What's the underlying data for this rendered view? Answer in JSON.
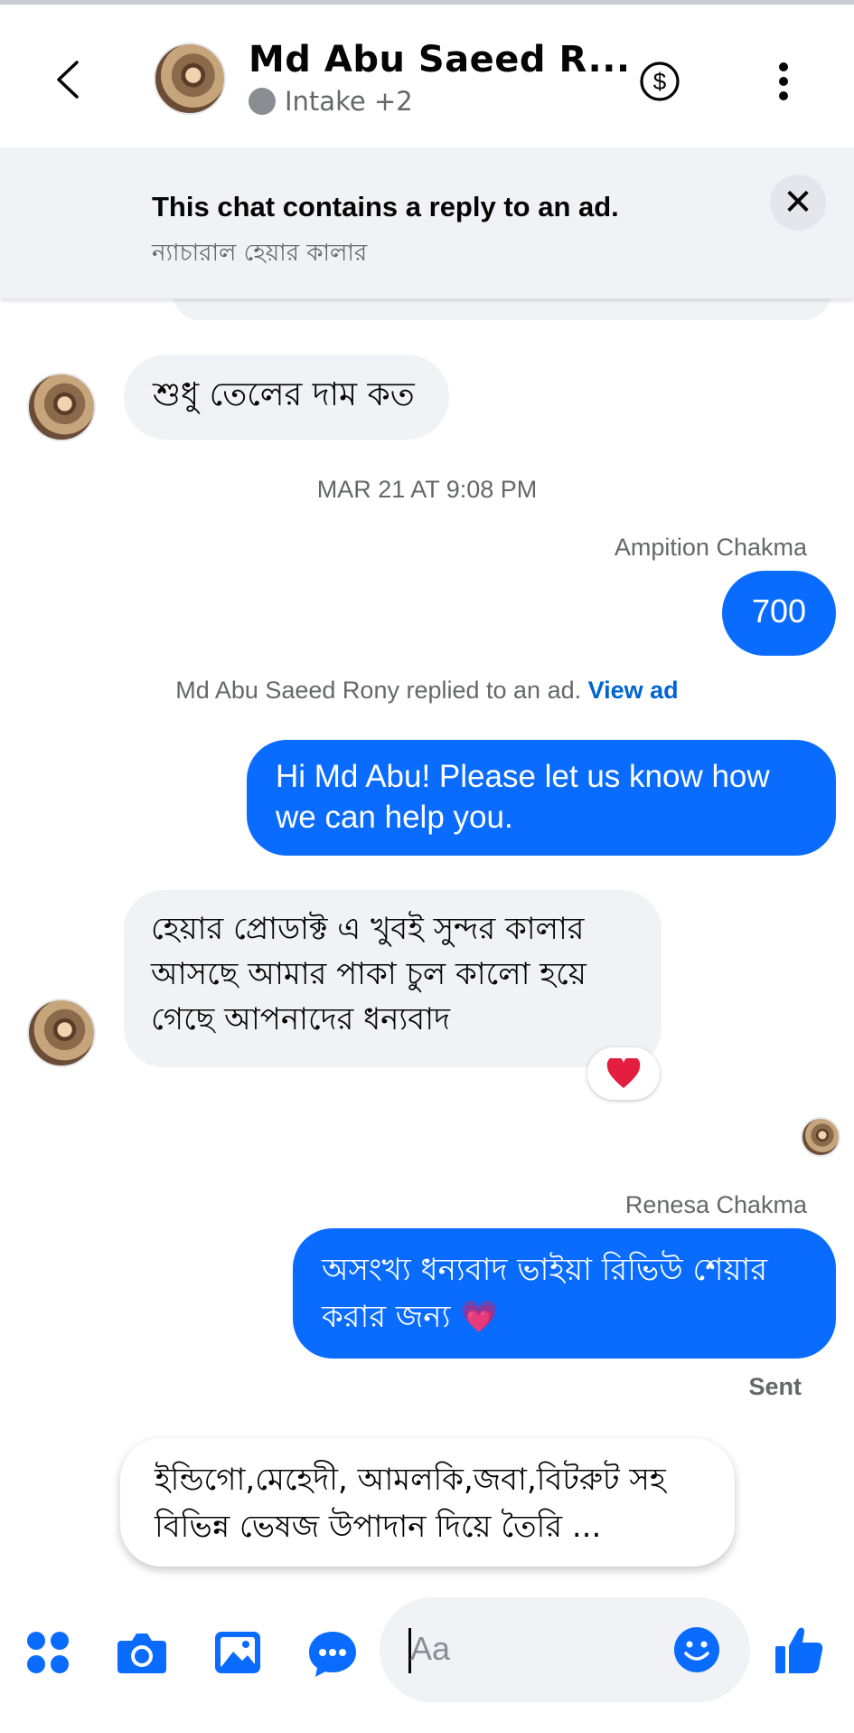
{
  "header": {
    "contact_name": "Md Abu Saeed R...",
    "status_label": "Intake +2",
    "icons": [
      "back-icon",
      "dollar-icon",
      "more-vertical-icon"
    ]
  },
  "ad_banner": {
    "title": "This chat contains a reply to an ad.",
    "subtitle": "ন্যাচারাল হেয়ার কালার",
    "close": "✕"
  },
  "messages": {
    "m1": "শুধু তেলের দাম কত",
    "timestamp": "MAR 21 AT 9:08 PM",
    "sender1": "Ampition Chakma",
    "m2": "700",
    "notice_text": "Md Abu Saeed Rony replied to an ad.",
    "notice_link": "View ad",
    "m3": "Hi Md Abu! Please let us know how we can help you.",
    "m4": "হেয়ার প্রোডাক্ট এ খুবই সুন্দর কালার আসছে আমার পাকা চুল কালো হয়ে গেছে আপনাদের  ধন্যবাদ",
    "reaction": "❤️",
    "sender2": "Renesa Chakma",
    "m5": "অসংখ্য ধন্যবাদ ভাইয়া রিভিউ শেয়ার করার জন্য",
    "m5_emoji": "💗",
    "status": "Sent"
  },
  "suggestion": "ইন্ডিগো,মেহেদী, আমলকি,জবা,বিটরুট সহ বিভিন্ন ভেষজ উপাদান দিয়ে তৈরি ...",
  "composer": {
    "placeholder": "Aa",
    "icons": [
      "apps-icon",
      "camera-icon",
      "image-icon",
      "chat-bubble-icon",
      "emoji-icon",
      "thumbs-up-icon"
    ]
  },
  "colors": {
    "accent": "#0a6cff",
    "incoming_bg": "#f0f2f5",
    "muted_text": "#65676b"
  }
}
